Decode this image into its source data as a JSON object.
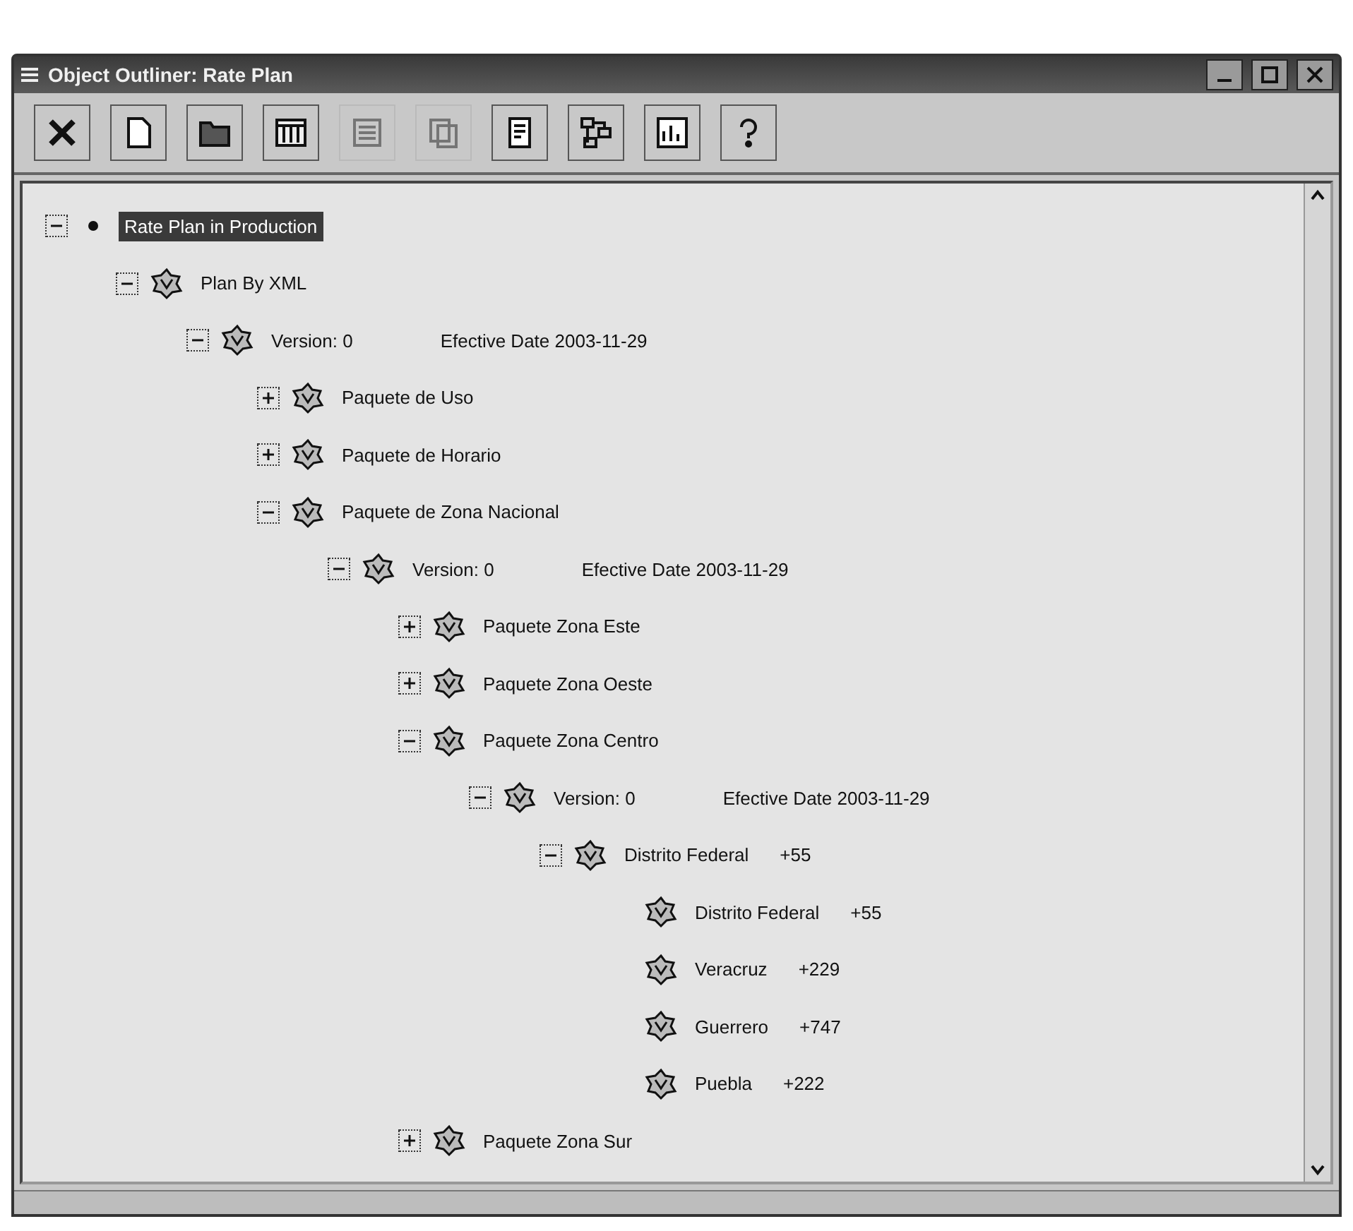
{
  "window": {
    "title": "Object Outliner: Rate Plan"
  },
  "toolbar": [
    {
      "kind": "delete",
      "disabled": false
    },
    {
      "kind": "new",
      "disabled": false
    },
    {
      "kind": "open",
      "disabled": false
    },
    {
      "kind": "grid",
      "disabled": false
    },
    {
      "kind": "list",
      "disabled": true
    },
    {
      "kind": "copy",
      "disabled": true
    },
    {
      "kind": "properties",
      "disabled": false
    },
    {
      "kind": "diagram",
      "disabled": false
    },
    {
      "kind": "report",
      "disabled": false
    },
    {
      "kind": "help",
      "disabled": false
    }
  ],
  "tree": [
    {
      "kind": "root",
      "label": "Rate Plan in Production",
      "selected": true,
      "expanded": true,
      "children": [
        {
          "kind": "object",
          "label": "Plan By XML",
          "selected": false,
          "expanded": true,
          "children": [
            {
              "kind": "object",
              "label": "Version: 0",
              "detail": "Efective Date 2003-11-29",
              "selected": false,
              "expanded": true,
              "children": [
                {
                  "kind": "object",
                  "label": "Paquete de Uso",
                  "selected": false,
                  "expanded": false
                },
                {
                  "kind": "object",
                  "label": "Paquete de Horario",
                  "selected": false,
                  "expanded": false
                },
                {
                  "kind": "object",
                  "label": "Paquete de Zona Nacional",
                  "selected": false,
                  "expanded": true,
                  "children": [
                    {
                      "kind": "object",
                      "label": "Version: 0",
                      "detail": "Efective Date 2003-11-29",
                      "selected": false,
                      "expanded": true,
                      "children": [
                        {
                          "kind": "object",
                          "label": "Paquete Zona Este",
                          "selected": false,
                          "expanded": false
                        },
                        {
                          "kind": "object",
                          "label": "Paquete Zona Oeste",
                          "selected": false,
                          "expanded": false
                        },
                        {
                          "kind": "object",
                          "label": "Paquete Zona Centro",
                          "selected": false,
                          "expanded": true,
                          "children": [
                            {
                              "kind": "object",
                              "label": "Version: 0",
                              "detail": "Efective Date 2003-11-29",
                              "selected": false,
                              "expanded": true,
                              "children": [
                                {
                                  "kind": "object",
                                  "label": "Distrito Federal",
                                  "detail": "+55",
                                  "selected": false,
                                  "expanded": true,
                                  "children": [
                                    {
                                      "kind": "object",
                                      "label": "Distrito Federal",
                                      "detail": "+55",
                                      "selected": false
                                    },
                                    {
                                      "kind": "object",
                                      "label": "Veracruz",
                                      "detail": "+229",
                                      "selected": false
                                    },
                                    {
                                      "kind": "object",
                                      "label": "Guerrero",
                                      "detail": "+747",
                                      "selected": false
                                    },
                                    {
                                      "kind": "object",
                                      "label": "Puebla",
                                      "detail": "+222",
                                      "selected": false
                                    }
                                  ]
                                }
                              ]
                            }
                          ]
                        },
                        {
                          "kind": "object",
                          "label": "Paquete Zona Sur",
                          "selected": false,
                          "expanded": false
                        }
                      ]
                    }
                  ]
                }
              ]
            }
          ]
        }
      ]
    }
  ]
}
